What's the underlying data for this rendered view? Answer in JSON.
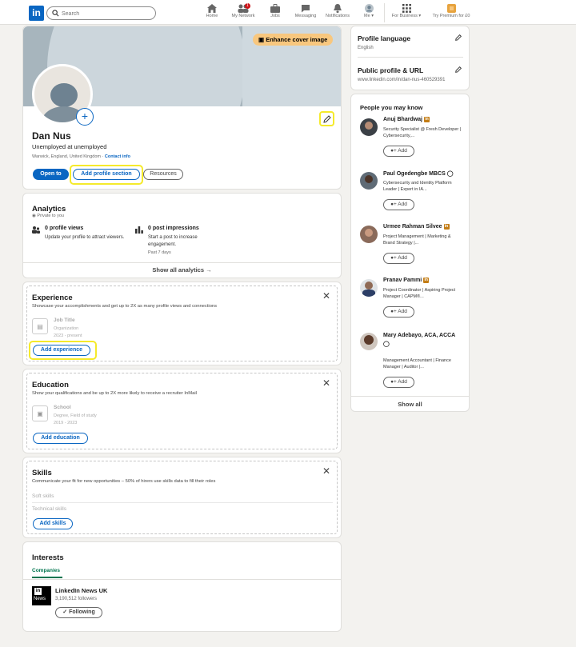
{
  "nav": {
    "logo": "in",
    "search_placeholder": "Search",
    "items": [
      {
        "label": "Home",
        "icon": "home-icon"
      },
      {
        "label": "My Network",
        "icon": "people-icon",
        "badge": "1"
      },
      {
        "label": "Jobs",
        "icon": "briefcase-icon"
      },
      {
        "label": "Messaging",
        "icon": "chat-icon"
      },
      {
        "label": "Notifications",
        "icon": "bell-icon"
      },
      {
        "label": "Me ▾",
        "icon": "avatar-icon"
      },
      {
        "label": "For Business ▾",
        "icon": "grid-icon"
      },
      {
        "label": "Try Premium for £0",
        "icon": "premium-icon"
      }
    ]
  },
  "profile": {
    "enhance_cover": "Enhance cover image",
    "name": "Dan Nus",
    "headline": "Unemployed at unemployed",
    "location": "Warwick, England, United Kingdom · ",
    "contact_info": "Contact info",
    "open_to": "Open to",
    "add_section": "Add profile section",
    "resources": "Resources"
  },
  "analytics": {
    "title": "Analytics",
    "private": "Private to you",
    "views_title": "0 profile views",
    "views_desc": "Update your profile to attract viewers.",
    "impr_title": "0 post impressions",
    "impr_desc": "Start a post to increase engagement.",
    "impr_sub": "Past 7 days",
    "show_all": "Show all analytics →"
  },
  "experience": {
    "title": "Experience",
    "desc": "Showcase your accomplishments and get up to 2X as many profile views and connections",
    "job_title": "Job Title",
    "org": "Organization",
    "dates": "2023 - present",
    "button": "Add experience"
  },
  "education": {
    "title": "Education",
    "desc": "Show your qualifications and be up to 2X more likely to receive a recruiter InMail",
    "school": "School",
    "degree": "Degree, Field of study",
    "dates": "2019 - 2023",
    "button": "Add education"
  },
  "skills": {
    "title": "Skills",
    "desc": "Communicate your fit for new opportunities – 50% of hirers use skills data to fill their roles",
    "soft": "Soft skills",
    "technical": "Technical skills",
    "button": "Add skills"
  },
  "interests": {
    "title": "Interests",
    "tab": "Companies",
    "company": "LinkedIn News UK",
    "company_logo_word": "News",
    "followers": "3,190,512 followers",
    "following": "✓ Following"
  },
  "sidebar": {
    "language_title": "Profile language",
    "language_value": "English",
    "url_title": "Public profile & URL",
    "url_value": "www.linkedin.com/in/dan-nus-460529391"
  },
  "pymk": {
    "title": "People you may know",
    "add_label": "Add",
    "show_all": "Show all",
    "people": [
      {
        "name": "Anuj Bhardwaj",
        "badge": "in",
        "desc": "Security Specialist @ Fresh Developer | Cybersecurity,..."
      },
      {
        "name": "Paul Ogedengbe MBCS",
        "badge": "verified",
        "desc": "Cybersecurity and Identity Platform Leader | Expert in IA..."
      },
      {
        "name": "Urmee Rahman Silvee",
        "badge": "in",
        "desc": "Project Management | Marketing & Brand Strategy |..."
      },
      {
        "name": "Pranav Pammi",
        "badge": "in",
        "desc": "Project Coordinator | Aspiring Project Manager | CAPM®..."
      },
      {
        "name": "Mary Adebayo, ACA, ACCA",
        "badge": "verified",
        "desc": "Management Accountant | Finance Manager | Auditor |..."
      }
    ]
  },
  "colors": {
    "brand": "#0a66c2",
    "highlight": "#f5ea2b",
    "premium": "#f8c77e"
  }
}
